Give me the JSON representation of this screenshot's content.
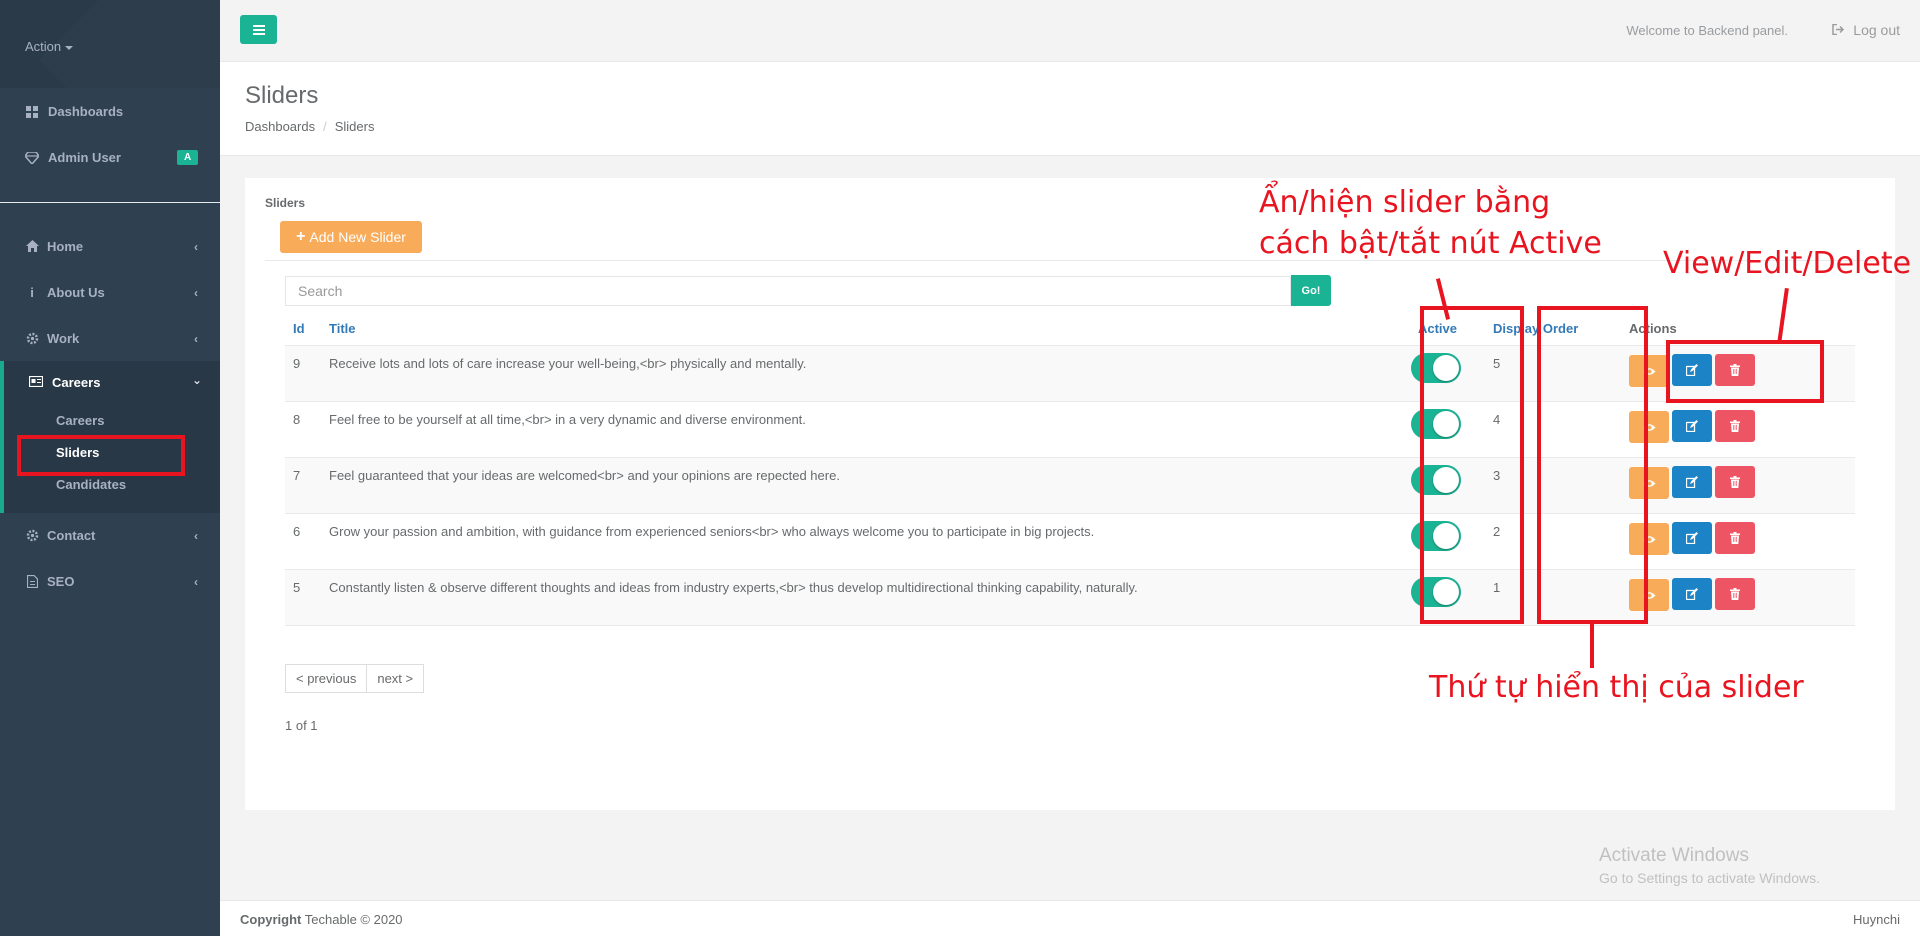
{
  "sidebar": {
    "action_label": "Action",
    "top_items": [
      {
        "label": "Dashboards",
        "icon": "th-large-icon"
      },
      {
        "label": "Admin User",
        "icon": "diamond-icon",
        "badge": "A"
      }
    ],
    "nav": [
      {
        "label": "Home",
        "icon": "home-icon"
      },
      {
        "label": "About Us",
        "icon": "info-icon"
      },
      {
        "label": "Work",
        "icon": "cog-icon"
      },
      {
        "label": "Careers",
        "icon": "id-card-icon"
      },
      {
        "label": "Contact",
        "icon": "cog-icon"
      },
      {
        "label": "SEO",
        "icon": "file-icon"
      }
    ],
    "careers_sub": [
      "Careers",
      "Sliders",
      "Candidates"
    ]
  },
  "topbar": {
    "welcome": "Welcome to Backend panel.",
    "logout": "Log out"
  },
  "heading": {
    "title": "Sliders",
    "breadcrumb": [
      "Dashboards",
      "Sliders"
    ]
  },
  "panel": {
    "label": "Sliders",
    "add_button": "Add New Slider",
    "search_placeholder": "Search",
    "go_label": "Go!"
  },
  "table": {
    "headers": {
      "id": "Id",
      "title": "Title",
      "active": "Active",
      "order": "Display Order",
      "actions": "Actions"
    },
    "rows": [
      {
        "id": "9",
        "title": "Receive lots and lots of care increase your well-being,<br> physically and mentally.",
        "active": true,
        "order": "5"
      },
      {
        "id": "8",
        "title": "Feel free to be yourself at all time,<br> in a very dynamic and diverse environment.",
        "active": true,
        "order": "4"
      },
      {
        "id": "7",
        "title": "Feel guaranteed that your ideas are welcomed<br> and your opinions are repected here.",
        "active": true,
        "order": "3"
      },
      {
        "id": "6",
        "title": "Grow your passion and ambition, with guidance from experienced seniors<br> who always welcome you to participate in big projects.",
        "active": true,
        "order": "2"
      },
      {
        "id": "5",
        "title": "Constantly listen & observe different thoughts and ideas from industry experts,<br> thus develop multidirectional thinking capability, naturally.",
        "active": true,
        "order": "1"
      }
    ]
  },
  "pagination": {
    "prev": "< previous",
    "next": "next >",
    "count": "1 of 1"
  },
  "annotations": {
    "active_line1": "Ẩn/hiện slider bằng",
    "active_line2": "cách bật/tắt nút Active",
    "actions_note": "View/Edit/Delete",
    "order_note": "Thứ tự hiển thị của slider"
  },
  "watermark": {
    "line1": "Activate Windows",
    "line2": "Go to Settings to activate Windows."
  },
  "footer": {
    "copyright_bold": "Copyright",
    "copyright_rest": " Techable © 2020",
    "right": "Huynchi"
  },
  "colors": {
    "accent": "#1ab394",
    "sidebar": "#2f4050",
    "annotation": "#e8141f",
    "link": "#337ab7"
  }
}
